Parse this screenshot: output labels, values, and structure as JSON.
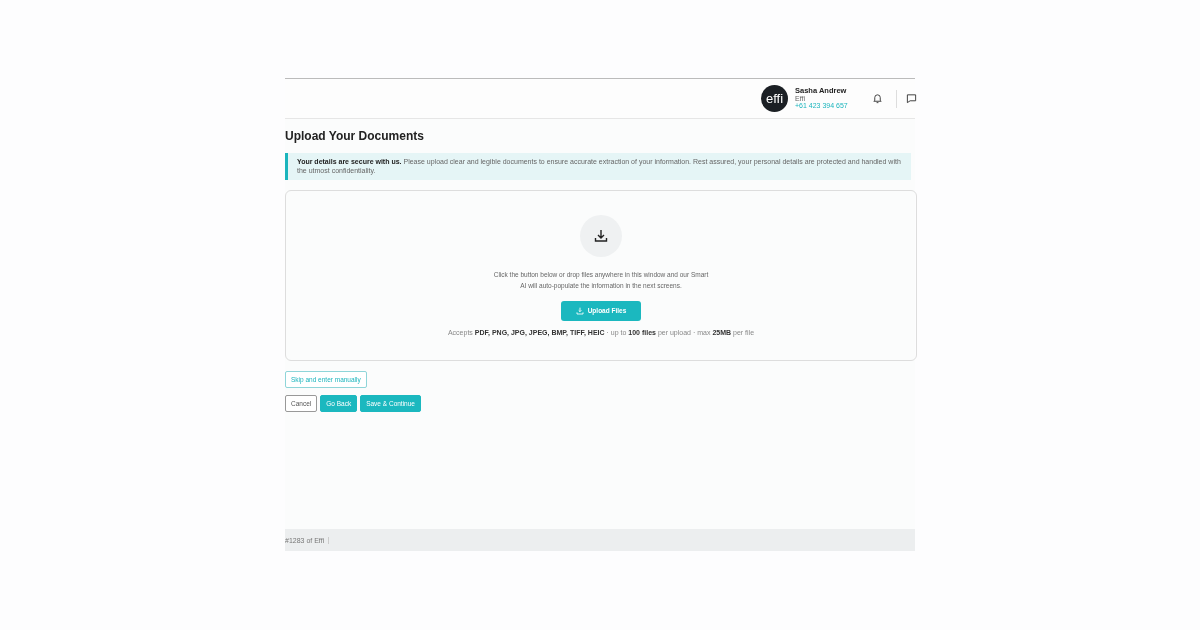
{
  "header": {
    "logo": "effi",
    "user_name": "Sasha Andrew",
    "user_org": "Effi",
    "user_phone": "+61 423 394 657"
  },
  "title": "Upload Your Documents",
  "notice": "**Your details are secure with us.** Please upload clear and legible documents to ensure accurate extraction of your information. Rest assured, your personal details are protected and handled with the utmost confidentiality.",
  "dropzone": {
    "instructions": "Click the button below or drop files anywhere in this window and our Smart AI will auto-populate the information in the next screens.",
    "button": "Upload Files",
    "accepts": "Accepts **PDF, PNG, JPG, JPEG, BMP, TIFF, HEIC** · up to **100 files** per upload · max **25MB** per file"
  },
  "skip_button": "Skip and enter manually",
  "buttons": [
    {
      "label": "Cancel",
      "kind": "outline"
    },
    {
      "label": "Go Back",
      "kind": "primary"
    },
    {
      "label": "Save & Continue",
      "kind": "primary"
    }
  ],
  "footer": "#1283 of Effi"
}
